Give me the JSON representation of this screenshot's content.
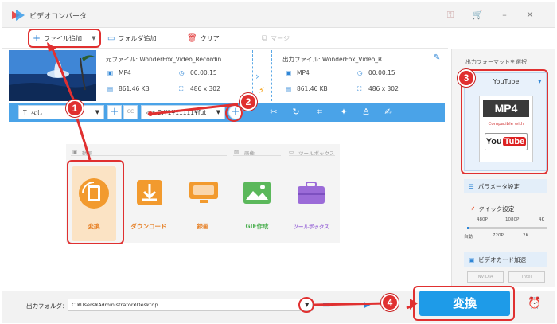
{
  "app": {
    "title": "ビデオコンバータ"
  },
  "toolbar": {
    "add_file": "ファイル追加",
    "add_folder": "フォルダ追加",
    "clear": "クリア",
    "merge": "マージ"
  },
  "file": {
    "source_name": "元ファイル: WonderFox_Video_Recordin...",
    "output_name": "出力ファイル: WonderFox_Video_R...",
    "src_format": "MP4",
    "src_duration": "00:00:15",
    "src_size": "861.46 KB",
    "src_resolution": "486 x 302",
    "out_format": "MP4",
    "out_duration": "00:00:15",
    "out_size": "861.46 KB",
    "out_resolution": "486 x 302"
  },
  "options": {
    "subtitle": "なし",
    "audio": "x D:¥1¥11111¥fut",
    "cc": "CC"
  },
  "categories": {
    "video": "動画",
    "image": "画像",
    "toolbox": "ツールボックス"
  },
  "tiles": {
    "convert": "変換",
    "download": "ダウンロード",
    "record": "録画",
    "gif": "GIF作成",
    "toolbox": "ツールボックス"
  },
  "right": {
    "select_format_label": "出力フォーマットを選択",
    "format_name": "YouTube",
    "format_box": "MP4",
    "compatible": "Compatible with",
    "logo_you": "You",
    "logo_tube": "Tube",
    "params": "パラメータ設定",
    "quick": "クイック設定",
    "marks_top": [
      "480P",
      "1080P",
      "4K"
    ],
    "marks_bottom": [
      "自動",
      "720P",
      "2K"
    ],
    "gpu": "ビデオカード加速",
    "nvidia": "NVIDIA",
    "intel": "Intel"
  },
  "bottom": {
    "output_folder_label": "出力フォルダ：",
    "output_path": "C:¥Users¥Administrator¥Desktop",
    "run": "変換"
  },
  "callouts": [
    "1",
    "2",
    "3",
    "4"
  ],
  "colors": {
    "accent": "#4aa3e8",
    "highlight": "#e03030",
    "orange": "#f5a623",
    "run_button": "#1e9be8"
  }
}
